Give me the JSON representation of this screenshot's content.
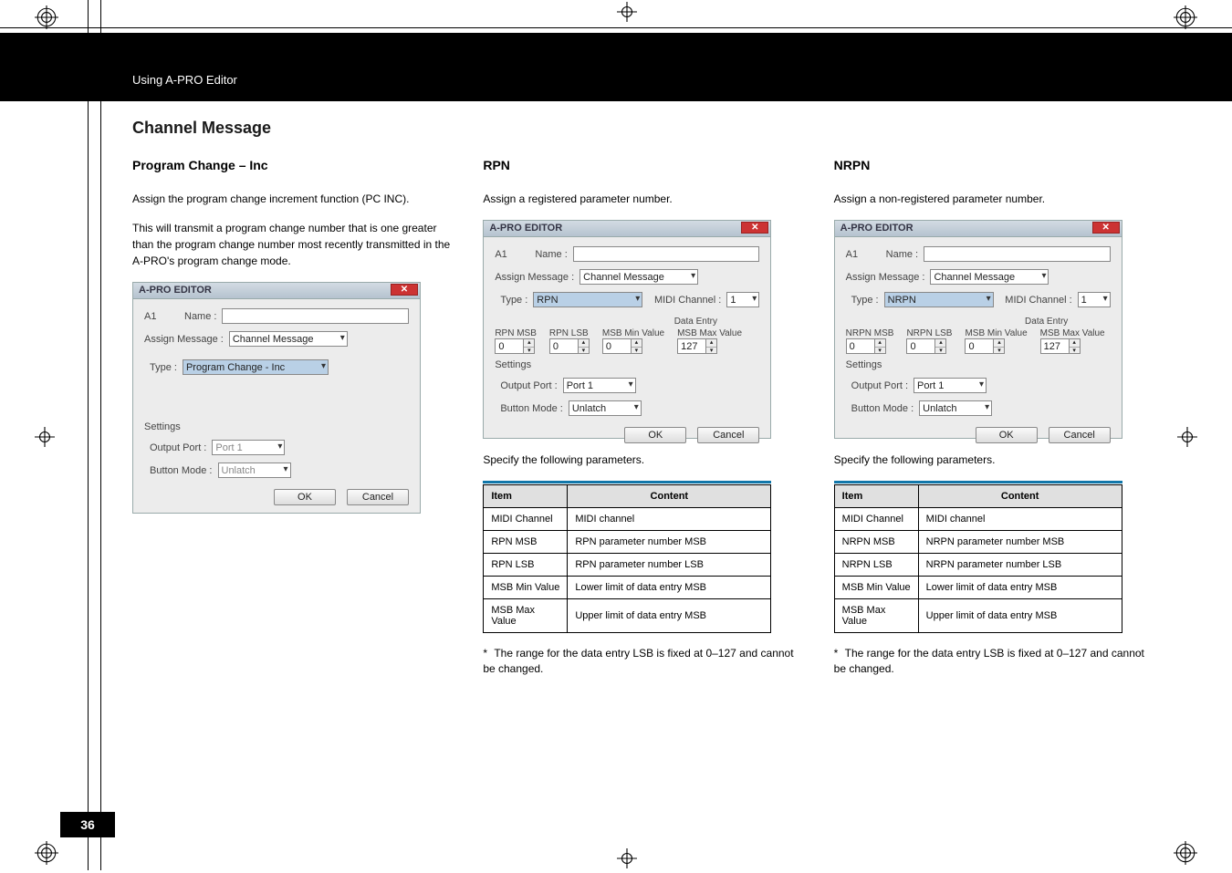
{
  "header": {
    "section": "Using A-PRO Editor"
  },
  "page_number": "36",
  "h1": "Channel Message",
  "col1": {
    "h2": "Program Change – Inc",
    "p1": "Assign the program change increment function (PC INC).",
    "p2": "This will transmit a program change number that is one greater than the program change number most recently transmitted in the A-PRO's program change mode.",
    "dlg": {
      "title": "A-PRO EDITOR",
      "a1": "A1",
      "name_lbl": "Name :",
      "assign_lbl": "Assign Message :",
      "assign_val": "Channel Message",
      "type_lbl": "Type :",
      "type_val": "Program Change - Inc",
      "settings": "Settings",
      "outport_lbl": "Output Port :",
      "outport_val": "Port 1",
      "btnmode_lbl": "Button Mode :",
      "btnmode_val": "Unlatch",
      "ok": "OK",
      "cancel": "Cancel"
    }
  },
  "col2": {
    "h2": "RPN",
    "p1": "Assign a registered parameter number.",
    "dlg": {
      "title": "A-PRO EDITOR",
      "a1": "A1",
      "name_lbl": "Name :",
      "assign_lbl": "Assign Message :",
      "assign_val": "Channel Message",
      "type_lbl": "Type :",
      "type_val": "RPN",
      "midich_lbl": "MIDI Channel :",
      "midich_val": "1",
      "de_lbl": "Data Entry",
      "msb_lbl": "RPN MSB",
      "lsb_lbl": "RPN LSB",
      "min_lbl": "MSB Min Value",
      "max_lbl": "MSB Max Value",
      "msb_val": "0",
      "lsb_val": "0",
      "min_val": "0",
      "max_val": "127",
      "settings": "Settings",
      "outport_lbl": "Output Port :",
      "outport_val": "Port 1",
      "btnmode_lbl": "Button Mode :",
      "btnmode_val": "Unlatch",
      "ok": "OK",
      "cancel": "Cancel"
    },
    "p2": "Specify the following parameters.",
    "table": {
      "h_item": "Item",
      "h_content": "Content",
      "rows": [
        [
          "MIDI Channel",
          "MIDI channel"
        ],
        [
          "RPN MSB",
          "RPN parameter number MSB"
        ],
        [
          "RPN LSB",
          "RPN parameter number LSB"
        ],
        [
          "MSB Min Value",
          "Lower limit of data entry MSB"
        ],
        [
          "MSB Max Value",
          "Upper limit of data entry MSB"
        ]
      ]
    },
    "note": "The range for the data entry LSB is fixed at 0–127 and cannot be changed."
  },
  "col3": {
    "h2": "NRPN",
    "p1": "Assign a non-registered parameter number.",
    "dlg": {
      "title": "A-PRO EDITOR",
      "a1": "A1",
      "name_lbl": "Name :",
      "assign_lbl": "Assign Message :",
      "assign_val": "Channel Message",
      "type_lbl": "Type :",
      "type_val": "NRPN",
      "midich_lbl": "MIDI Channel :",
      "midich_val": "1",
      "de_lbl": "Data Entry",
      "msb_lbl": "NRPN MSB",
      "lsb_lbl": "NRPN LSB",
      "min_lbl": "MSB Min Value",
      "max_lbl": "MSB Max Value",
      "msb_val": "0",
      "lsb_val": "0",
      "min_val": "0",
      "max_val": "127",
      "settings": "Settings",
      "outport_lbl": "Output Port :",
      "outport_val": "Port 1",
      "btnmode_lbl": "Button Mode :",
      "btnmode_val": "Unlatch",
      "ok": "OK",
      "cancel": "Cancel"
    },
    "p2": "Specify the following parameters.",
    "table": {
      "h_item": "Item",
      "h_content": "Content",
      "rows": [
        [
          "MIDI Channel",
          "MIDI channel"
        ],
        [
          "NRPN MSB",
          "NRPN parameter number MSB"
        ],
        [
          "NRPN LSB",
          "NRPN parameter number LSB"
        ],
        [
          "MSB Min Value",
          "Lower limit of data entry MSB"
        ],
        [
          "MSB Max Value",
          "Upper limit of data entry MSB"
        ]
      ]
    },
    "note": "The range for the data entry LSB is fixed at 0–127 and cannot be changed."
  }
}
